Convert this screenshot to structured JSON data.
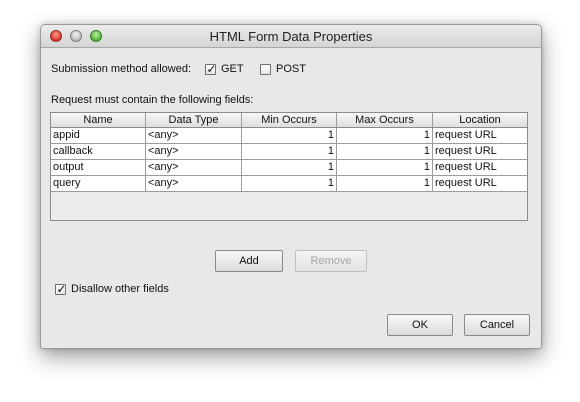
{
  "window": {
    "title": "HTML Form Data Properties"
  },
  "submission": {
    "label": "Submission method allowed:",
    "get_label": "GET",
    "get_checked": true,
    "post_label": "POST",
    "post_checked": false
  },
  "fields_section": {
    "label": "Request must contain the following fields:"
  },
  "table": {
    "columns": [
      "Name",
      "Data Type",
      "Min Occurs",
      "Max Occurs",
      "Location"
    ],
    "rows": [
      {
        "name": "appid",
        "type": "<any>",
        "min": "1",
        "max": "1",
        "location": "request URL"
      },
      {
        "name": "callback",
        "type": "<any>",
        "min": "1",
        "max": "1",
        "location": "request URL"
      },
      {
        "name": "output",
        "type": "<any>",
        "min": "1",
        "max": "1",
        "location": "request URL"
      },
      {
        "name": "query",
        "type": "<any>",
        "min": "1",
        "max": "1",
        "location": "request URL"
      }
    ]
  },
  "buttons": {
    "add": "Add",
    "remove": "Remove",
    "ok": "OK",
    "cancel": "Cancel"
  },
  "disallow": {
    "label": "Disallow other fields",
    "checked": true
  }
}
